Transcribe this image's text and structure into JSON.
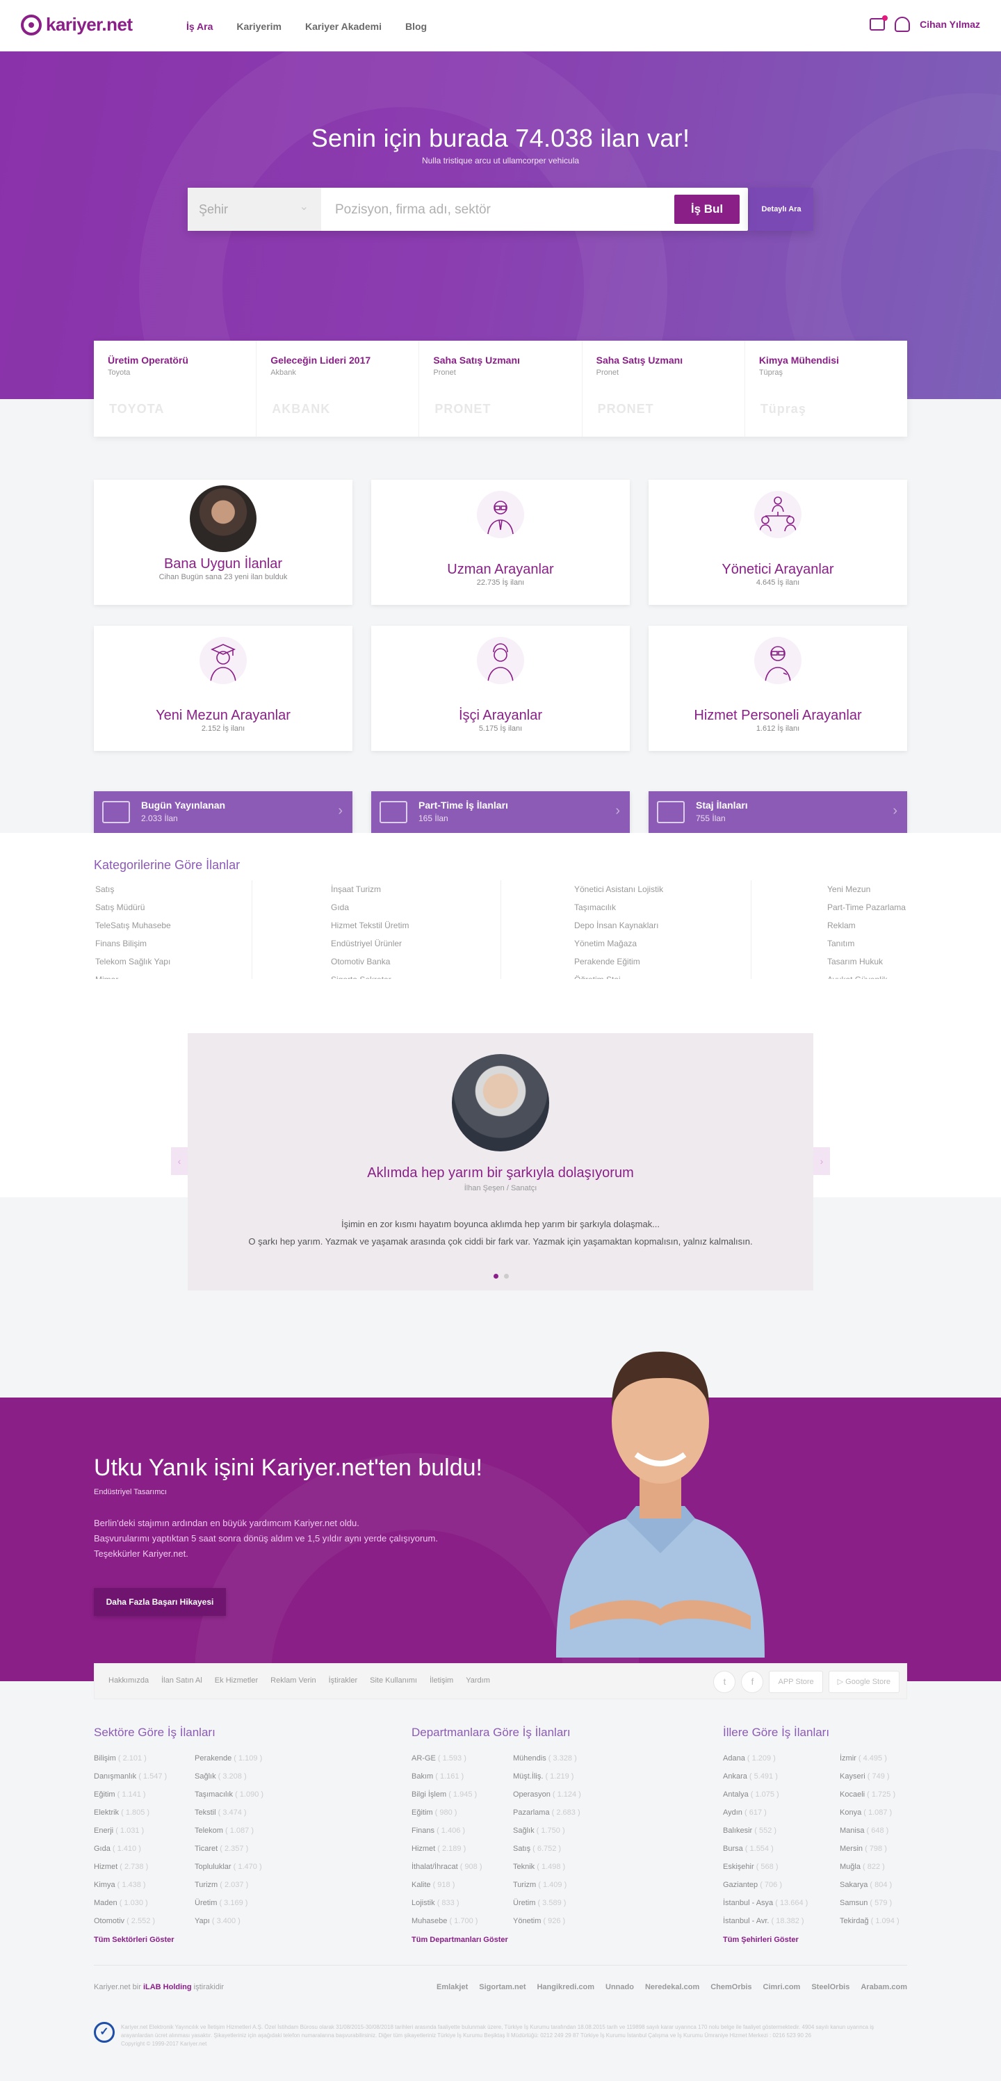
{
  "header": {
    "logo": "kariyer.net",
    "nav": [
      "İş Ara",
      "Kariyerim",
      "Kariyer Akademi",
      "Blog"
    ],
    "user": "Cihan Yılmaz"
  },
  "hero": {
    "title": "Senin için burada 74.038 ilan var!",
    "subtitle": "Nulla tristique arcu ut ullamcorper vehicula",
    "city_placeholder": "Şehir",
    "search_placeholder": "Pozisyon, firma adı, sektör",
    "search_button": "İş Bul",
    "advanced_button": "Detaylı Ara"
  },
  "featured": [
    {
      "title": "Üretim Operatörü",
      "company": "Toyota",
      "logo": "TOYOTA"
    },
    {
      "title": "Geleceğin Lideri 2017",
      "company": "Akbank",
      "logo": "AKBANK"
    },
    {
      "title": "Saha Satış Uzmanı",
      "company": "Pronet",
      "logo": "PRONET"
    },
    {
      "title": "Saha Satış Uzmanı",
      "company": "Pronet",
      "logo": "PRONET"
    },
    {
      "title": "Kimya Mühendisi",
      "company": "Tüpraş",
      "logo": "Tüpraş"
    }
  ],
  "cards": [
    {
      "title": "Bana Uygun İlanlar",
      "sub": "Cihan Bugün sana 23 yeni ilan bulduk"
    },
    {
      "title": "Uzman Arayanlar",
      "sub": "22.735 İş ilanı",
      "icon": "expert-icon"
    },
    {
      "title": "Yönetici Arayanlar",
      "sub": "4.645 İş ilanı",
      "icon": "manager-icon"
    },
    {
      "title": "Yeni Mezun Arayanlar",
      "sub": "2.152 İş ilanı",
      "icon": "graduate-icon"
    },
    {
      "title": "İşçi Arayanlar",
      "sub": "5.175 İş ilanı",
      "icon": "worker-icon"
    },
    {
      "title": "Hizmet Personeli Arayanlar",
      "sub": "1.612 İş ilanı",
      "icon": "service-icon"
    }
  ],
  "bars": [
    {
      "title": "Bugün Yayınlanan",
      "sub": "2.033 İlan",
      "icon": "calendar-icon"
    },
    {
      "title": "Part-Time İş İlanları",
      "sub": "165 İlan",
      "icon": "certificate-icon"
    },
    {
      "title": "Staj İlanları",
      "sub": "755 İlan",
      "icon": "briefcase-icon"
    }
  ],
  "categories": {
    "title": "Kategorilerine Göre İlanlar",
    "columns": [
      [
        "Satış",
        "Satış Müdürü",
        "TeleSatış Muhasebe",
        "Finans Bilişim",
        "Telekom Sağlık Yapı",
        "Mimar"
      ],
      [
        "İnşaat Turizm",
        "Gıda",
        "Hizmet Tekstil Üretim",
        "Endüstriyel Ürünler",
        "Otomotiv Banka",
        "Sigorta Sekreter"
      ],
      [
        "Yönetici Asistanı Lojistik",
        "Taşımacılık",
        "Depo İnsan Kaynakları",
        "Yönetim Mağaza",
        "Perakende Eğitim",
        "Öğretim Staj"
      ],
      [
        "Yeni Mezun",
        "Part-Time Pazarlama",
        "Reklam",
        "Tanıtım",
        "Tasarım Hukuk",
        "Avukat Güvenlik"
      ]
    ]
  },
  "testimonial": {
    "quote": "Aklımda hep yarım bir şarkıyla dolaşıyorum",
    "person": "İlhan Şeşen / Sanatçı",
    "line1": "İşimin en zor kısmı hayatım boyunca aklımda hep yarım bir şarkıyla dolaşmak...",
    "line2": "O şarkı hep yarım. Yazmak ve yaşamak arasında çok ciddi bir fark var. Yazmak için yaşamaktan kopmalısın, yalnız kalmalısın."
  },
  "story": {
    "title": "Utku Yanık işini Kariyer.net'ten buldu!",
    "role": "Endüstriyel Tasarımcı",
    "text1": "Berlin'deki stajımın ardından en büyük yardımcım Kariyer.net oldu.",
    "text2": "Başvurularımı yaptıktan 5 saat sonra dönüş aldım ve 1,5 yıldır aynı yerde çalışıyorum.",
    "text3": "Teşekkürler Kariyer.net.",
    "button": "Daha Fazla Başarı Hikayesi"
  },
  "linkbar": {
    "links": [
      "Hakkımızda",
      "İlan Satın Al",
      "Ek Hizmetler",
      "Reklam Verin",
      "İştirakler",
      "Site Kullanımı",
      "İletişim",
      "Yardım"
    ],
    "app_store": "APP Store",
    "google_store": "Google Store"
  },
  "footer": {
    "sector_title": "Sektöre Göre İş İlanları",
    "sector_a": [
      [
        "Bilişim",
        "( 2.101 )"
      ],
      [
        "Danışmanlık",
        "( 1.547 )"
      ],
      [
        "Eğitim",
        "( 1.141 )"
      ],
      [
        "Elektrik",
        "( 1.805 )"
      ],
      [
        "Enerji",
        "( 1.031 )"
      ],
      [
        "Gıda",
        "( 1.410 )"
      ],
      [
        "Hizmet",
        "( 2.738 )"
      ],
      [
        "Kimya",
        "( 1.438 )"
      ],
      [
        "Maden",
        "( 1.030 )"
      ],
      [
        "Otomotiv",
        "( 2.552 )"
      ]
    ],
    "sector_b": [
      [
        "Perakende",
        "( 1.109 )"
      ],
      [
        "Sağlık",
        "( 3.208 )"
      ],
      [
        "Taşımacılık",
        "( 1.090 )"
      ],
      [
        "Tekstil",
        "( 3.474 )"
      ],
      [
        "Telekom",
        "( 1.087 )"
      ],
      [
        "Ticaret",
        "( 2.357 )"
      ],
      [
        "Topluluklar",
        "( 1.470 )"
      ],
      [
        "Turizm",
        "( 2.037 )"
      ],
      [
        "Üretim",
        "( 3.169 )"
      ],
      [
        "Yapı",
        "( 3.400 )"
      ]
    ],
    "sector_all": "Tüm Sektörleri Göster",
    "dept_title": "Departmanlara Göre İş İlanları",
    "dept_a": [
      [
        "AR-GE",
        "( 1.593 )"
      ],
      [
        "Bakım",
        "( 1.161 )"
      ],
      [
        "Bilgi İşlem",
        "( 1.945 )"
      ],
      [
        "Eğitim",
        "( 980 )"
      ],
      [
        "Finans",
        "( 1.406 )"
      ],
      [
        "Hizmet",
        "( 2.189 )"
      ],
      [
        "İthalat/İhracat",
        "( 908 )"
      ],
      [
        "Kalite",
        "( 918 )"
      ],
      [
        "Lojistik",
        "( 833 )"
      ],
      [
        "Muhasebe",
        "( 1.700 )"
      ]
    ],
    "dept_b": [
      [
        "Mühendis",
        "( 3.328 )"
      ],
      [
        "Müşt.İliş.",
        "( 1.219 )"
      ],
      [
        "Operasyon",
        "( 1.124 )"
      ],
      [
        "Pazarlama",
        "( 2.683 )"
      ],
      [
        "Sağlık",
        "( 1.750 )"
      ],
      [
        "Satış",
        "( 6.752 )"
      ],
      [
        "Teknik",
        "( 1.498 )"
      ],
      [
        "Turizm",
        "( 1.409 )"
      ],
      [
        "Üretim",
        "( 3.589 )"
      ],
      [
        "Yönetim",
        "( 926 )"
      ]
    ],
    "dept_all": "Tüm Departmanları Göster",
    "city_title": "İllere Göre İş İlanları",
    "city_a": [
      [
        "Adana",
        "( 1.209 )"
      ],
      [
        "Ankara",
        "( 5.491 )"
      ],
      [
        "Antalya",
        "( 1.075 )"
      ],
      [
        "Aydın",
        "( 617 )"
      ],
      [
        "Balıkesir",
        "( 552 )"
      ],
      [
        "Bursa",
        "( 1.554 )"
      ],
      [
        "Eskişehir",
        "( 568 )"
      ],
      [
        "Gaziantep",
        "( 706 )"
      ],
      [
        "İstanbul - Asya",
        "( 13.664 )"
      ],
      [
        "İstanbul - Avr.",
        "( 18.382 )"
      ]
    ],
    "city_b": [
      [
        "İzmir",
        "( 4.495 )"
      ],
      [
        "Kayseri",
        "( 749 )"
      ],
      [
        "Kocaeli",
        "( 1.725 )"
      ],
      [
        "Konya",
        "( 1.087 )"
      ],
      [
        "Manisa",
        "( 648 )"
      ],
      [
        "Mersin",
        "( 798 )"
      ],
      [
        "Muğla",
        "( 822 )"
      ],
      [
        "Sakarya",
        "( 804 )"
      ],
      [
        "Samsun",
        "( 579 )"
      ],
      [
        "Tekirdağ",
        "( 1.094 )"
      ]
    ],
    "city_all": "Tüm Şehirleri Göster",
    "ilab_prefix": "Kariyer.net bir",
    "ilab_name": "iLAB Holding",
    "ilab_suffix": "iştirakidir",
    "partners": [
      "Emlakjet",
      "Sigortam.net",
      "Hangikredi.com",
      "Unnado",
      "Neredekal.com",
      "ChemOrbis",
      "Cimri.com",
      "SteelOrbis",
      "Arabam.com"
    ],
    "legal1": "Kariyer.net Elektronik Yayıncılık ve İletişim Hizmetleri A.Ş. Özel İstihdam Bürosu olarak 31/08/2015-30/08/2018 tarihleri arasında faaliyette bulunmak üzere, Türkiye İş Kurumu tarafından 18.08.2015 tarih ve 119898 sayılı karar uyarınca 170 nolu belge ile faaliyet göstermektedir. 4904 sayılı kanun uyarınca iş arayanlardan ücret alınması yasaktır. Şikayetleriniz için aşağıdaki telefon numaralarına başvurabilirsiniz. Diğer tüm şikayetleriniz Türkiye İş Kurumu Beşiktaş İl Müdürlüğü: 0212 249 29 87 Türkiye İş Kurumu İstanbul Çalışma ve İş Kurumu Ümraniye Hizmet Merkezi : 0216 523 90 26",
    "copyright": "Copyright © 1999-2017 Kariyer.net"
  }
}
